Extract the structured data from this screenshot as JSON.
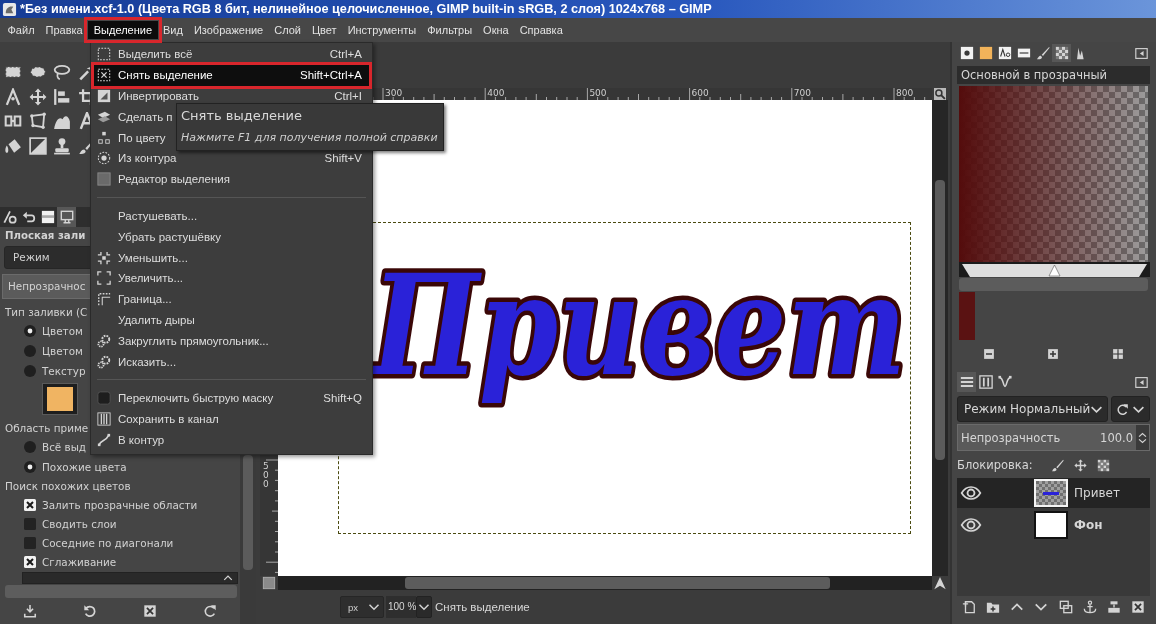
{
  "window": {
    "title": "*Без имени.xcf-1.0 (Цвета RGB 8 бит, нелинейное целочисленное, GIMP built-in sRGB, 2 слоя) 1024x768 – GIMP"
  },
  "menubar": [
    {
      "label": "Файл",
      "selected": false,
      "annotated": false
    },
    {
      "label": "Правка",
      "selected": false,
      "annotated": false
    },
    {
      "label": "Выделение",
      "selected": true,
      "annotated": true
    },
    {
      "label": "Вид",
      "selected": false,
      "annotated": false
    },
    {
      "label": "Изображение",
      "selected": false,
      "annotated": false
    },
    {
      "label": "Слой",
      "selected": false,
      "annotated": false
    },
    {
      "label": "Цвет",
      "selected": false,
      "annotated": false
    },
    {
      "label": "Инструменты",
      "selected": false,
      "annotated": false
    },
    {
      "label": "Фильтры",
      "selected": false,
      "annotated": false
    },
    {
      "label": "Окна",
      "selected": false,
      "annotated": false
    },
    {
      "label": "Справка",
      "selected": false,
      "annotated": false
    }
  ],
  "menu": {
    "sections": [
      [
        {
          "label": "Выделить всё",
          "shortcut": "Ctrl+A",
          "selected": false,
          "annotated": false
        },
        {
          "label": "Снять выделение",
          "shortcut": "Shift+Ctrl+A",
          "selected": true,
          "annotated": true
        },
        {
          "label": "Инвертировать",
          "shortcut": "Ctrl+I",
          "selected": false,
          "annotated": false
        },
        {
          "label": "Сделать п",
          "selected": false,
          "annotated": false
        },
        {
          "label": "По цвету",
          "selected": false,
          "annotated": false
        },
        {
          "label": "Из контура",
          "shortcut": "Shift+V",
          "selected": false,
          "annotated": false
        },
        {
          "label": "Редактор выделения",
          "selected": false,
          "annotated": false
        }
      ],
      [
        {
          "label": "Растушевать...",
          "selected": false,
          "annotated": false
        },
        {
          "label": "Убрать растушёвку",
          "selected": false,
          "annotated": false
        },
        {
          "label": "Уменьшить...",
          "selected": false,
          "annotated": false
        },
        {
          "label": "Увеличить...",
          "selected": false,
          "annotated": false
        },
        {
          "label": "Граница...",
          "selected": false,
          "annotated": false
        },
        {
          "label": "Удалить дыры",
          "selected": false,
          "annotated": false
        },
        {
          "label": "Закруглить прямоугольник...",
          "selected": false,
          "annotated": false
        },
        {
          "label": "Исказить...",
          "selected": false,
          "annotated": false
        }
      ],
      [
        {
          "label": "Переключить быструю маску",
          "shortcut": "Shift+Q",
          "selected": false,
          "annotated": false
        },
        {
          "label": "Сохранить в канал",
          "selected": false,
          "annotated": false
        },
        {
          "label": "В контур",
          "selected": false,
          "annotated": false
        }
      ]
    ]
  },
  "tooltip": {
    "title": "Снять выделение",
    "hint": "Нажмите F1 для получения полной справки"
  },
  "tool_options": {
    "tabs": [
      {
        "selected": false
      },
      {
        "selected": false
      },
      {
        "selected": false
      },
      {
        "selected": true
      }
    ],
    "title": "Плоская зали",
    "mode": "Режим",
    "opacity": "Непрозрачнос",
    "groups": [
      {
        "label": "Тип заливки (С",
        "kind": "radio",
        "pattern": true,
        "options": [
          {
            "label": "Цветом",
            "selected": true
          },
          {
            "label": "Цветом",
            "selected": false
          },
          {
            "label": "Текстур",
            "selected": false
          }
        ]
      },
      {
        "label": "Область приме",
        "kind": "radio",
        "options": [
          {
            "label": "Всё выд",
            "selected": false
          },
          {
            "label": "Похожие цвета",
            "selected": true
          }
        ]
      },
      {
        "label": "Поиск похожих цветов",
        "kind": "checkbox",
        "options": [
          {
            "label": "Залить прозрачные области",
            "checked": true
          },
          {
            "label": "Сводить слои",
            "checked": false
          },
          {
            "label": "Соседние по диагонали",
            "checked": false
          },
          {
            "label": "Сглаживание",
            "checked": true
          }
        ]
      }
    ]
  },
  "canvas": {
    "ruler": [
      "300",
      "400",
      "500",
      "600",
      "700",
      "800"
    ],
    "vertical_ruler": [
      "500"
    ],
    "text": "Привет"
  },
  "status_bar": {
    "unit": "px",
    "zoom": "100 %",
    "message": "Снять выделение"
  },
  "dock": {
    "tabs": [
      {
        "selected": false
      },
      {
        "selected": false
      },
      {
        "selected": false
      },
      {
        "selected": false
      },
      {
        "selected": false
      },
      {
        "selected": true
      },
      {
        "selected": false
      }
    ],
    "gradient_name": "Основной в прозрачный"
  },
  "layers_panel": {
    "tabs": [
      {
        "selected": true
      },
      {
        "selected": false
      },
      {
        "selected": false
      }
    ],
    "mode": "Режим Нормальный",
    "opacity_label": "Непрозрачность",
    "opacity": "100.0",
    "lock_label": "Блокировка:",
    "layers": [
      {
        "name": "Привет",
        "kind": "text",
        "selected": true,
        "visible": true
      },
      {
        "name": "Фон",
        "kind": "background",
        "selected": false,
        "visible": true
      }
    ]
  }
}
